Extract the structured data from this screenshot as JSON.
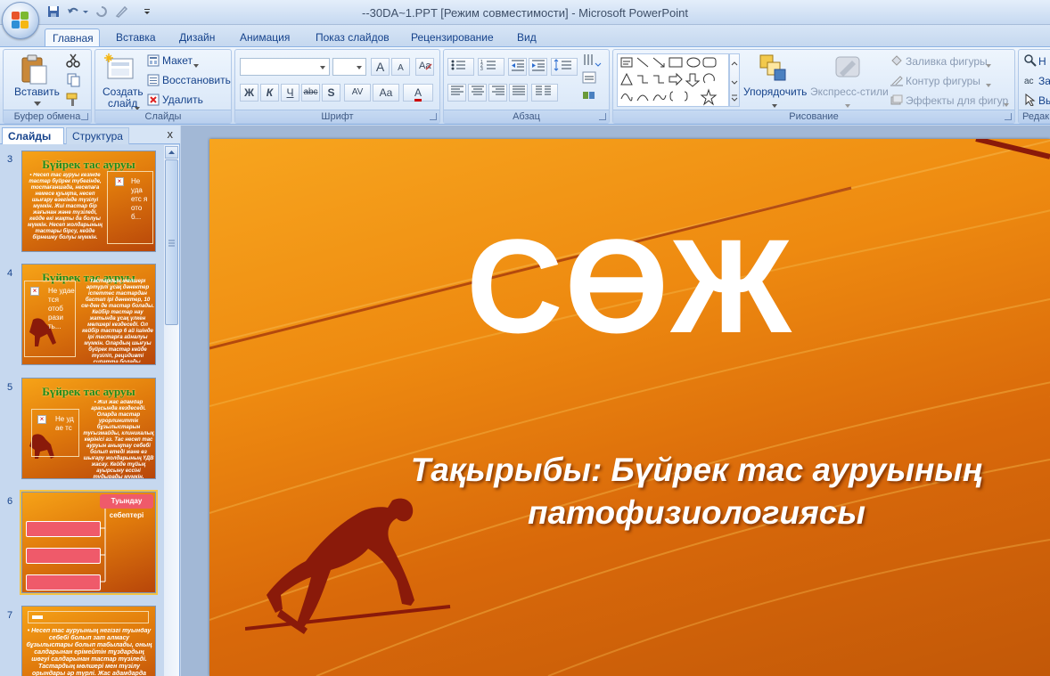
{
  "window": {
    "title": "--30DA~1.PPT [Режим совместимости] - Microsoft PowerPoint"
  },
  "ribbon_tabs": [
    "Главная",
    "Вставка",
    "Дизайн",
    "Анимация",
    "Показ слайдов",
    "Рецензирование",
    "Вид"
  ],
  "ribbon": {
    "clipboard": {
      "paste": "Вставить",
      "label": "Буфер обмена"
    },
    "slides": {
      "new_slide_1": "Создать",
      "new_slide_2": "слайд",
      "layout": "Макет",
      "reset": "Восстановить",
      "delete": "Удалить",
      "label": "Слайды"
    },
    "font": {
      "label": "Шрифт",
      "bold": "Ж",
      "italic": "К",
      "underline": "Ч",
      "strike": "abc",
      "shadow": "S",
      "spacing": "AV",
      "case": "Aa",
      "color": "A",
      "grow": "A",
      "shrink": "A"
    },
    "paragraph": {
      "label": "Абзац"
    },
    "drawing": {
      "arrange": "Упорядочить",
      "quick_styles": "Экспресс-стили",
      "fill": "Заливка фигуры",
      "outline": "Контур фигуры",
      "effects": "Эффекты для фигур",
      "label": "Рисование"
    },
    "editing": {
      "find": "Н",
      "replace": "За",
      "select": "Вы",
      "label": "Редак"
    }
  },
  "panel": {
    "tabs": [
      "Слайды",
      "Структура"
    ],
    "close": "x"
  },
  "thumbnails": [
    {
      "num": "3",
      "title": "Бүйрек тас ауруы",
      "body": "• Несеп тас ауруы кезінде тастар бүйрек түбегінде, тостағаншада, несепаға немесе қуықта, несеп шығару өзегінде түзілуі мүмкін. Жиі тастар бір жағынан және түзіледі, кейде екі жақты да болуы мүмкін. Несеп жолдарының тастары бірсу, кейде бірнешеу болуы мүмкін.",
      "placeholder": "Не уда етс я ото б..."
    },
    {
      "num": "4",
      "title": "Бүйрек тас ауруы",
      "body": "Тастардың мөлшері әртүрлі ұсақ дәнектер іспеттес тастардан бастап ірі дәнектер, 10 см-ден де тастар болады. Кейбір тастар нау жатында ұсақ үлкен мөлшері кездеседі. Ол кейбір тастар 6 ай ішінде ірі тастарға айналуы мүмкін. Олардың шығуы бүйрек тастар кейде түзіліп, рецидивті сипатта болады.",
      "placeholder": "Не удае тся отоб рази ть..."
    },
    {
      "num": "5",
      "title": "Бүйрек тас ауруы",
      "body": "• Жиі жас адамдар арасында кездеседі. Оларда тастар урорлиниттік бұзылыстарын туғызмайды, клиникалық көрінісі аз. Тас несеп тас ауруын анықтау себебі болып етеді және өз шығару жолдарының ҮДВ жасау. Кейде тұйық ауырсыну ессіні тудырады мүмкін.",
      "placeholder": "Не уд ае тс"
    },
    {
      "num": "6",
      "title": "Туындау себептері",
      "body": ""
    },
    {
      "num": "7",
      "title": "",
      "body": "• Несеп тас ауруының негізгі туындау себебі болып зат алмасу бұзылыстары болып табылады, оның салдарынан ерімейтін тұздардың шөгуі салдарынан тастар түзіледі. Тастардың мөлшері мен түзілу орындары әр түрлі. Жас адамдарда"
    }
  ],
  "slide": {
    "title": "СӨЖ",
    "subtitle_line1": "Тақырыбы: Бүйрек тас ауруының",
    "subtitle_line2": "патофизиологиясы"
  },
  "colors": {
    "slide_orange": "#ee8a10",
    "silhouette": "#8a1a0a",
    "title_green": "#1e8a1e"
  }
}
